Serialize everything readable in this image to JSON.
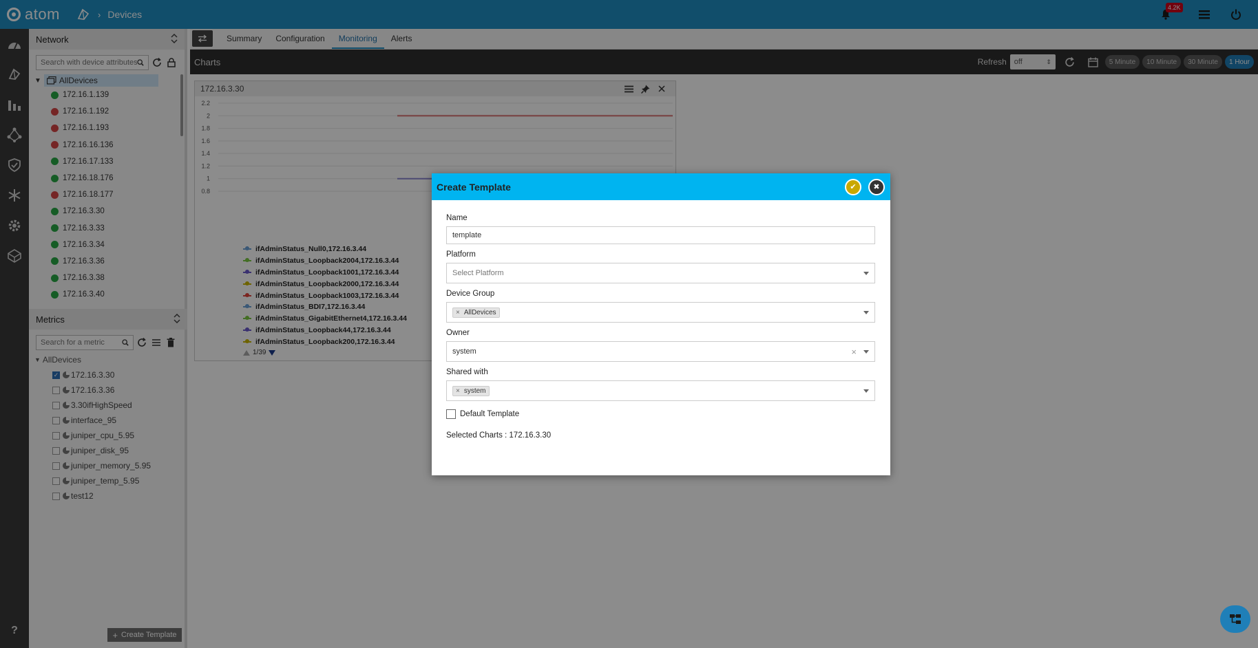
{
  "app": {
    "brand": "atom",
    "breadcrumb": "Devices",
    "notification_count": "4.2K"
  },
  "sidebar": {
    "network_title": "Network",
    "search_placeholder": "Search with device attributes",
    "root": "AllDevices",
    "devices": [
      {
        "ip": "172.16.1.139",
        "status": "green"
      },
      {
        "ip": "172.16.1.192",
        "status": "red"
      },
      {
        "ip": "172.16.1.193",
        "status": "red"
      },
      {
        "ip": "172.16.16.136",
        "status": "red"
      },
      {
        "ip": "172.16.17.133",
        "status": "green"
      },
      {
        "ip": "172.16.18.176",
        "status": "green"
      },
      {
        "ip": "172.16.18.177",
        "status": "red"
      },
      {
        "ip": "172.16.3.30",
        "status": "green"
      },
      {
        "ip": "172.16.3.33",
        "status": "green"
      },
      {
        "ip": "172.16.3.34",
        "status": "green"
      },
      {
        "ip": "172.16.3.36",
        "status": "green"
      },
      {
        "ip": "172.16.3.38",
        "status": "green"
      },
      {
        "ip": "172.16.3.40",
        "status": "green"
      }
    ],
    "metrics_title": "Metrics",
    "metric_search_placeholder": "Search for a metric",
    "metric_root": "AllDevices",
    "metrics": [
      {
        "label": "172.16.3.30",
        "checked": true
      },
      {
        "label": "172.16.3.36",
        "checked": false
      },
      {
        "label": "3.30ifHighSpeed",
        "checked": false
      },
      {
        "label": "interface_95",
        "checked": false
      },
      {
        "label": "juniper_cpu_5.95",
        "checked": false
      },
      {
        "label": "juniper_disk_95",
        "checked": false
      },
      {
        "label": "juniper_memory_5.95",
        "checked": false
      },
      {
        "label": "juniper_temp_5.95",
        "checked": false
      },
      {
        "label": "test12",
        "checked": false
      }
    ],
    "create_template_label": "Create Template"
  },
  "tabs": [
    {
      "label": "Summary",
      "active": false
    },
    {
      "label": "Configuration",
      "active": false
    },
    {
      "label": "Monitoring",
      "active": true
    },
    {
      "label": "Alerts",
      "active": false
    }
  ],
  "charts_bar": {
    "title": "Charts",
    "refresh_label": "Refresh",
    "refresh_value": "off",
    "ranges": [
      {
        "label": "5 Minute",
        "active": false
      },
      {
        "label": "10 Minute",
        "active": false
      },
      {
        "label": "30 Minute",
        "active": false
      },
      {
        "label": "1 Hour",
        "active": true
      }
    ]
  },
  "chart_card": {
    "title": "172.16.3.30",
    "pager": "1/39"
  },
  "chart_data": {
    "type": "line",
    "title": "172.16.3.30",
    "ylim": [
      0.8,
      2.2
    ],
    "yticks": [
      "2.2",
      "2",
      "1.8",
      "1.6",
      "1.4",
      "1.2",
      "1",
      "0.8"
    ],
    "series": [
      {
        "name": "ifAdminStatus_Null0,172.16.3.44",
        "color": "#6aa0d8",
        "value": 2
      },
      {
        "name": "ifAdminStatus_Loopback2004,172.16.3.44",
        "color": "#7ac943",
        "value": 2
      },
      {
        "name": "ifAdminStatus_Loopback1001,172.16.3.44",
        "color": "#6a5acd",
        "value": 1
      },
      {
        "name": "ifAdminStatus_Loopback2000,172.16.3.44",
        "color": "#c8b400",
        "value": 2
      },
      {
        "name": "ifAdminStatus_Loopback1003,172.16.3.44",
        "color": "#e0443c",
        "value": 2
      },
      {
        "name": "ifAdminStatus_BDI7,172.16.3.44",
        "color": "#6aa0d8",
        "value": 2
      },
      {
        "name": "ifAdminStatus_GigabitEthernet4,172.16.3.44",
        "color": "#7ac943",
        "value": 2
      },
      {
        "name": "ifAdminStatus_Loopback44,172.16.3.44",
        "color": "#6a5acd",
        "value": 2
      },
      {
        "name": "ifAdminStatus_Loopback200,172.16.3.44",
        "color": "#c8b400",
        "value": 2
      }
    ]
  },
  "modal": {
    "title": "Create Template",
    "name_label": "Name",
    "name_value": "template",
    "platform_label": "Platform",
    "platform_placeholder": "Select Platform",
    "device_group_label": "Device Group",
    "device_group_chip": "AllDevices",
    "owner_label": "Owner",
    "owner_value": "system",
    "shared_label": "Shared with",
    "shared_chip": "system",
    "default_label": "Default Template",
    "selected_charts": "Selected Charts : 172.16.3.30"
  }
}
